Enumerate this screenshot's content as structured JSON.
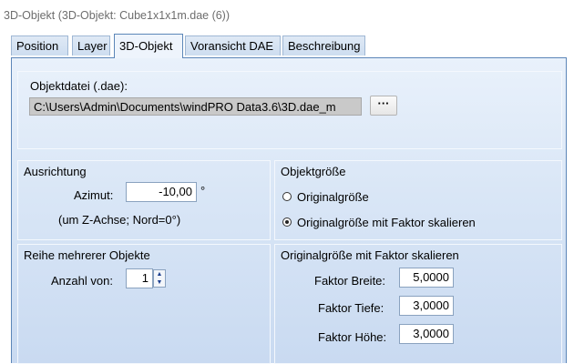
{
  "window": {
    "title": "3D-Objekt  (3D-Objekt: Cube1x1x1m.dae (6))"
  },
  "tabs": [
    {
      "label": "Position",
      "active": false
    },
    {
      "label": "Layer",
      "active": false
    },
    {
      "label": "3D-Objekt",
      "active": true
    },
    {
      "label": "Voransicht DAE",
      "active": false
    },
    {
      "label": "Beschreibung",
      "active": false
    }
  ],
  "objektdatei": {
    "label": "Objektdatei (.dae):",
    "path": "C:\\Users\\Admin\\Documents\\windPRO Data3.6\\3D.dae_m",
    "browse_label": "···"
  },
  "ausrichtung": {
    "heading": "Ausrichtung",
    "azimut_label": "Azimut:",
    "azimut_value": "-10,00",
    "unit": "°",
    "hint": "(um Z-Achse; Nord=0°)"
  },
  "objektgroesse": {
    "heading": "Objektgröße",
    "options": [
      {
        "label": "Originalgröße",
        "selected": false
      },
      {
        "label": "Originalgröße mit Faktor skalieren",
        "selected": true
      }
    ]
  },
  "reihe": {
    "heading": "Reihe mehrerer Objekte",
    "anzahl_label": "Anzahl von:",
    "anzahl_value": "1"
  },
  "faktor": {
    "heading": "Originalgröße mit Faktor skalieren",
    "breite_label": "Faktor Breite:",
    "breite_value": "5,0000",
    "tiefe_label": "Faktor Tiefe:",
    "tiefe_value": "3,0000",
    "hoehe_label": "Faktor Höhe:",
    "hoehe_value": "3,0000"
  },
  "colors": {
    "panel_border": "#5c86b8",
    "panel_top": "#e9f1fb",
    "panel_bottom": "#c9daf1"
  }
}
